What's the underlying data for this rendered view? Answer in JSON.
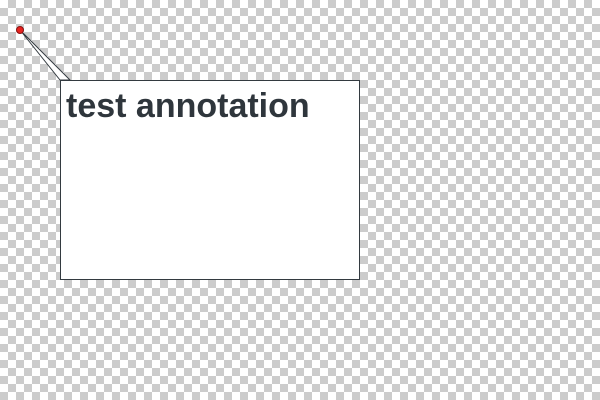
{
  "annotation": {
    "text": "test annotation"
  },
  "colors": {
    "anchor": "#e8231f",
    "text": "#2f363c",
    "border": "#333a40",
    "checker_dark": "#cccccc",
    "checker_light": "#ffffff"
  }
}
